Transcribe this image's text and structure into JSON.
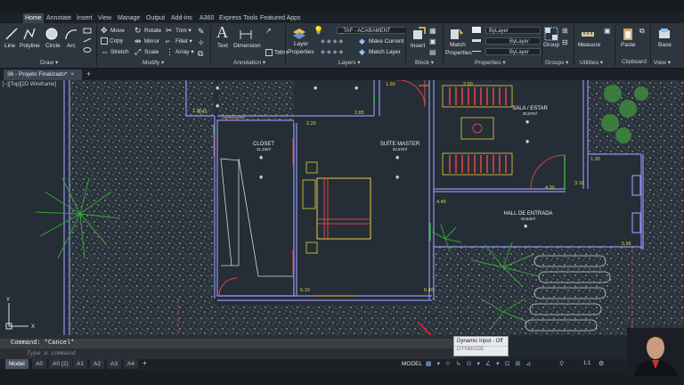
{
  "ribbon_tabs": [
    "Home",
    "Annotate",
    "Insert",
    "View",
    "Manage",
    "Output",
    "Add-ins",
    "A360",
    "Express Tools",
    "Featured Apps"
  ],
  "draw": {
    "line": "Line",
    "polyline": "Polyline",
    "circle": "Circle",
    "arc": "Arc",
    "title": "Draw ▾"
  },
  "modify": {
    "move": "Move",
    "rotate": "Rotate",
    "trim": "Trim ▾",
    "copy": "Copy",
    "mirror": "Mirror",
    "fillet": "Fillet ▾",
    "stretch": "Stretch",
    "scale": "Scale",
    "array": "Array ▾",
    "title": "Modify ▾"
  },
  "annotation": {
    "text": "Text",
    "dimension": "Dimension",
    "table": "Table",
    "title": "Annotation ▾"
  },
  "layers": {
    "layer_properties": "Layer",
    "layer_properties2": "Properties",
    "current_layer": "_TAF - ACABAMENT",
    "make_current": "Make Current",
    "match_layer": "Match Layer",
    "title": "Layers ▾"
  },
  "block": {
    "insert": "Insert",
    "title": "Block ▾"
  },
  "properties": {
    "match": "Match",
    "match2": "Properties",
    "bylayer1": "ByLayer",
    "bylayer2": "ByLayer",
    "bylayer3": "ByLayer",
    "title": "Properties ▾"
  },
  "groups": {
    "group": "Group",
    "title": "Groups ▾"
  },
  "utilities": {
    "measure": "Measure",
    "title": "Utilities ▾"
  },
  "clipboard": {
    "paste": "Paste",
    "title": "Clipboard"
  },
  "view": {
    "base": "Base",
    "title": "View ▾"
  },
  "file_tab": "36 - Projeto Finalizado*",
  "viewport_label": "[−][Top][2D Wireframe]",
  "rooms": {
    "closet": "CLOSET",
    "closet_area": "11,13m²",
    "suite": "SUÍTE MASTER",
    "suite_area": "22,67m²",
    "sala": "SALA / ESTAR",
    "sala_area": "20,07m²",
    "hall": "HALL DE ENTRADA",
    "hall_area": "10,54m²"
  },
  "dims": {
    "d120": "1.20",
    "d145": "1.45",
    "d285": "2.85",
    "d220": "2.20",
    "d160": "1.60",
    "d130": "1.30",
    "d250": "2.50",
    "d430": "4.30",
    "d310": "3.10",
    "d445": "4.45",
    "d595": "5.95",
    "d510": "5.10",
    "d640": "6.40"
  },
  "command": {
    "history": "Command: *Cancel*",
    "placeholder": "Type a command"
  },
  "layout_tabs": [
    "Model",
    "A0",
    "A0 (2)",
    "A1",
    "A2",
    "A3",
    "A4"
  ],
  "status": {
    "model": "MODEL",
    "scale": "1:1"
  },
  "tooltip": {
    "title": "Dynamic Input - Off",
    "cmd": "DYNMODE"
  }
}
